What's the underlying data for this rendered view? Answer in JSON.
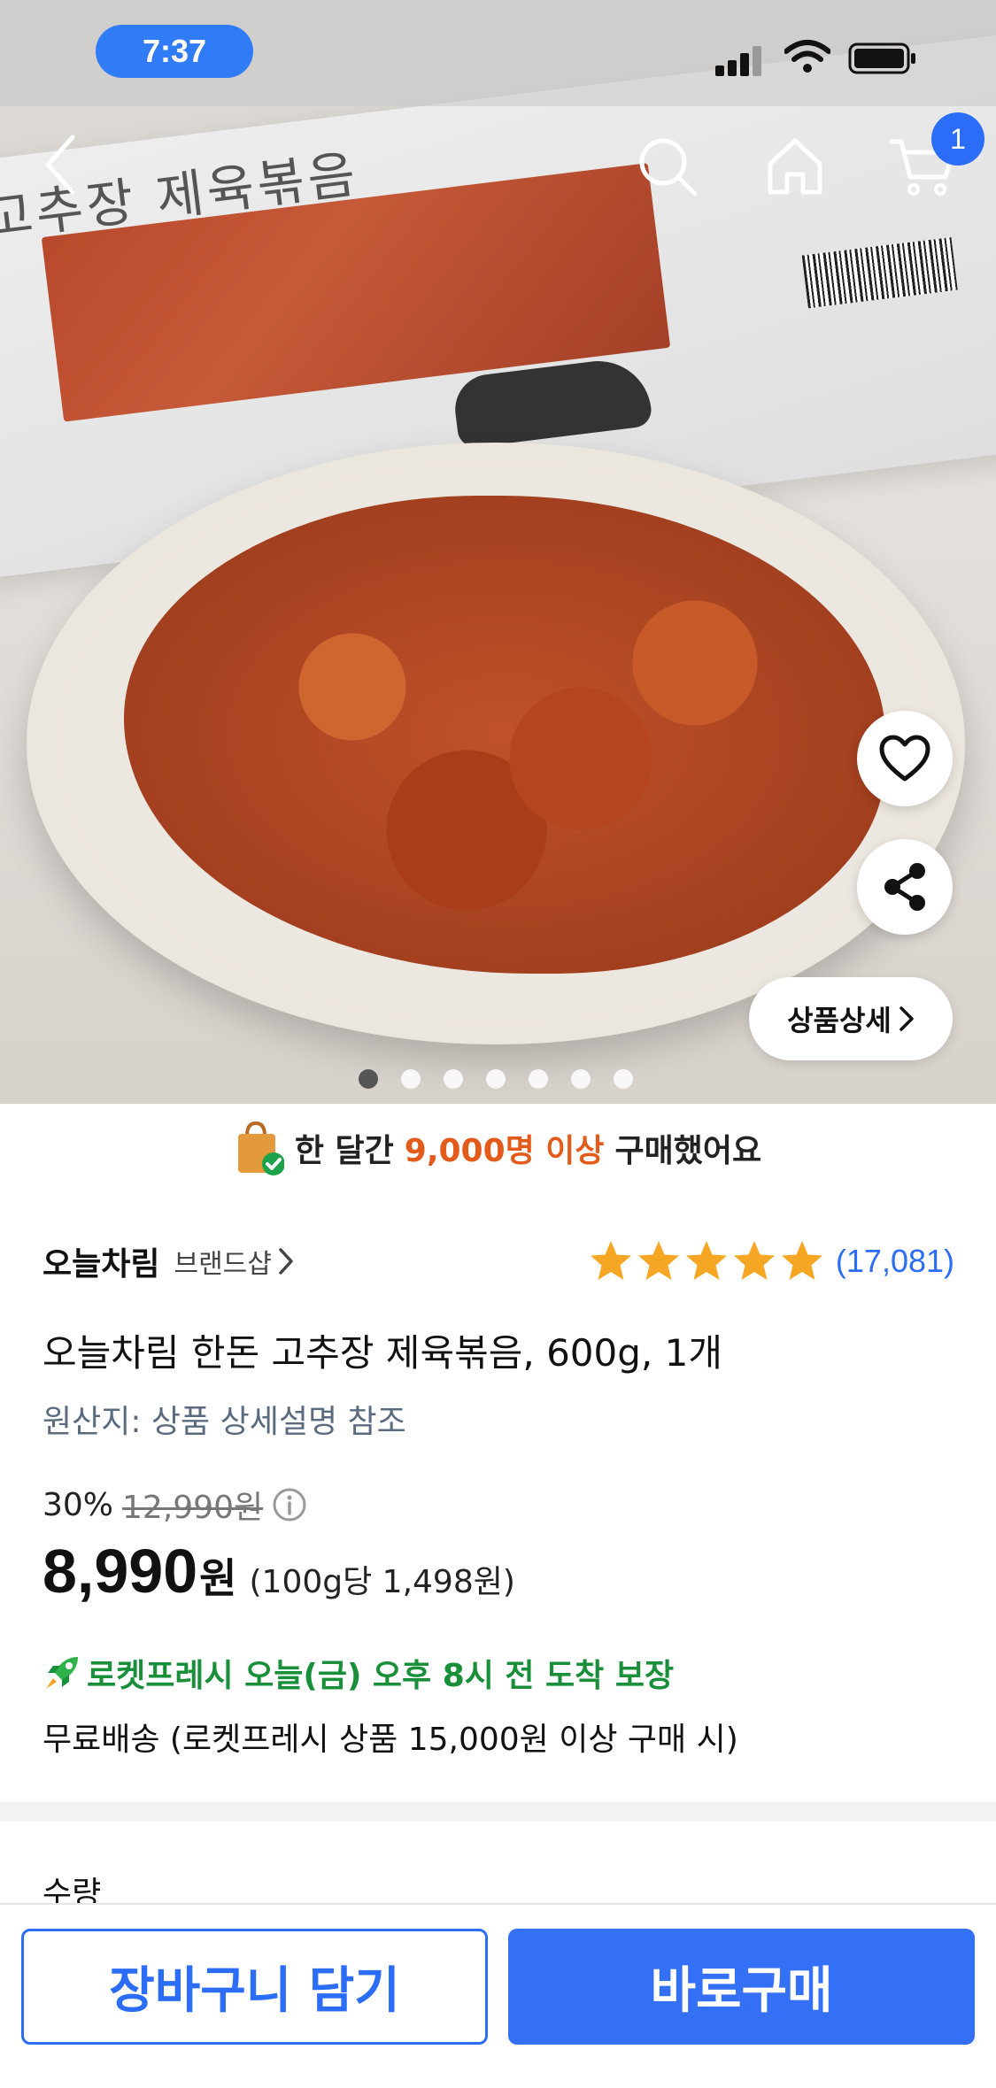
{
  "status_bar": {
    "time": "7:37"
  },
  "nav": {
    "cart_count": "1"
  },
  "hero": {
    "detail_label": "상품상세",
    "image_count": 7,
    "active_index": 0,
    "package_text": "고추장 제육볶음"
  },
  "purchase_banner": {
    "prefix": "한 달간",
    "highlight": "9,000명 이상",
    "suffix": "구매했어요"
  },
  "product": {
    "brand": "오늘차림",
    "brand_shop": "브랜드샵",
    "rating": 5,
    "review_count": "(17,081)",
    "title": "오늘차림 한돈 고추장 제육볶음, 600g, 1개",
    "origin": "원산지: 상품 상세설명 참조",
    "discount": "30%",
    "original_price": "12,990원",
    "price": "8,990",
    "price_unit": "원",
    "unit_price": "(100g당 1,498원)",
    "delivery": "로켓프레시 오늘(금) 오후 8시 전 도착 보장",
    "shipping": "무료배송 (로켓프레시 상품 15,000원 이상 구매 시)",
    "quantity_label": "수량"
  },
  "actions": {
    "add_to_cart": "장바구니 담기",
    "buy_now": "바로구매"
  },
  "colors": {
    "accent_blue": "#2b6df6",
    "highlight_orange": "#e35b1a",
    "rocket_green": "#1a8f3a",
    "star_gold": "#f5a623"
  }
}
